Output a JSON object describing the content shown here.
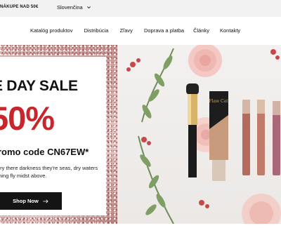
{
  "topbar": {
    "promo_text": "NÁKUPE NAD 50€",
    "language": "Slovenčina"
  },
  "nav": {
    "items": [
      "Katalóg produktov",
      "Distribúcia",
      "Zľavy",
      "Doprava a platba",
      "Články",
      "Kontakty"
    ]
  },
  "hero": {
    "title": "E DAY SALE",
    "discount": "50%",
    "promo_code": "romo code CN67EW*",
    "description": "dry there darkness they're seas, dry waters thing fly midst above.",
    "cta_label": "Shop Now",
    "product_label": "Flaw Cat",
    "accent_color": "#c7262c"
  }
}
